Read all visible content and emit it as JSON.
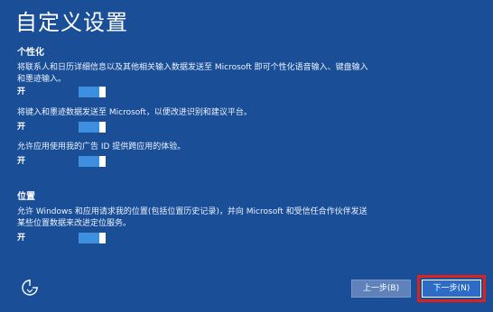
{
  "title": "自定义设置",
  "personalization": {
    "heading": "个性化",
    "items": [
      {
        "description": "将联系人和日历详细信息以及其他相关输入数据发送至 Microsoft 即可个性化语音输入、键盘输入和墨迹输入。",
        "state": "开",
        "on": true
      },
      {
        "description": "将键入和墨迹数据发送至 Microsoft，以便改进识别和建议平台。",
        "state": "开",
        "on": true
      },
      {
        "description": "允许应用使用我的广告 ID 提供跨应用的体验。",
        "state": "开",
        "on": true
      }
    ]
  },
  "location": {
    "heading": "位置",
    "items": [
      {
        "description": "允许 Windows 和应用请求我的位置(包括位置历史记录)，并向 Microsoft 和受信任合作伙伴发送某些位置数据来改进定位服务。",
        "state": "开",
        "on": true
      }
    ]
  },
  "footer": {
    "back_label": "上一步(B)",
    "next_label": "下一步(N)"
  },
  "colors": {
    "background": "#1a4f98",
    "toggle_on": "#3d8fe0",
    "highlight": "#e0201b"
  },
  "icons": {
    "accessibility": "ease-of-access-icon"
  }
}
